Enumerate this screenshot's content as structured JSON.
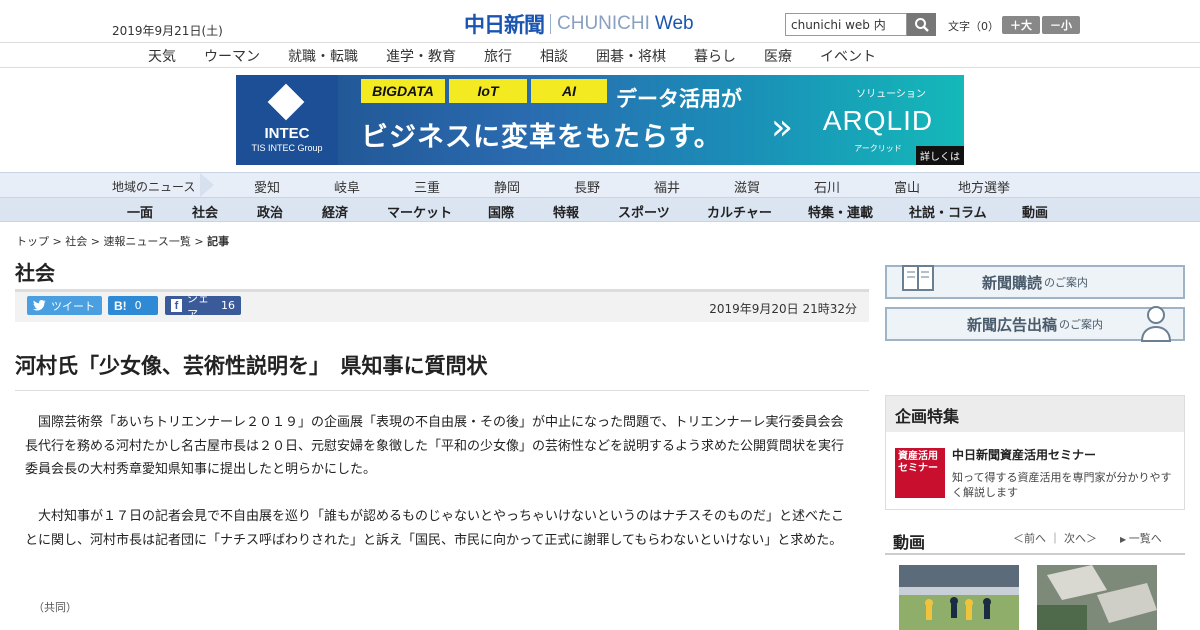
{
  "header": {
    "date": "2019年9月21日(土)",
    "logo_kanji": "中日新聞",
    "logo_latin": "CHUNICHI",
    "logo_web": "Web",
    "search_value": "chunichi web 内",
    "font_size_label": "文字（0）",
    "font_larger": "＋大",
    "font_smaller": "－小"
  },
  "category_nav": [
    "天気",
    "ウーマン",
    "就職・転職",
    "進学・教育",
    "旅行",
    "相談",
    "囲碁・将棋",
    "暮らし",
    "医療",
    "イベント"
  ],
  "banner": {
    "company": "INTEC",
    "company_sub": "TIS INTEC Group",
    "tags": [
      "BIGDATA",
      "IoT",
      "AI"
    ],
    "line1": "データ活用が",
    "line2": "ビジネスに変革をもたらす。",
    "solution": "ソリューション",
    "product": "ARQLID",
    "product_sub": "アークリッド",
    "more": "詳しくは"
  },
  "regional_nav": {
    "label": "地域のニュース",
    "items": [
      "愛知",
      "岐阜",
      "三重",
      "静岡",
      "長野",
      "福井",
      "滋賀",
      "石川",
      "富山",
      "地方選挙"
    ]
  },
  "section_nav": [
    "一面",
    "社会",
    "政治",
    "経済",
    "マーケット",
    "国際",
    "特報",
    "スポーツ",
    "カルチャー",
    "特集・連載",
    "社説・コラム",
    "動画"
  ],
  "breadcrumb": {
    "items": [
      "トップ",
      "社会",
      "速報ニュース一覧"
    ],
    "separator": " > ",
    "current": "記事"
  },
  "section_title": "社会",
  "share": {
    "tweet": "ツイート",
    "hatena_count": "0",
    "fb_label": "シェア",
    "fb_count": "16",
    "published": "2019年9月20日 21時32分"
  },
  "article": {
    "headline": "河村氏「少女像、芸術性説明を」　県知事に質問状",
    "paragraphs": [
      "国際芸術祭「あいちトリエンナーレ２０１９」の企画展「表現の不自由展・その後」が中止になった問題で、トリエンナーレ実行委員会会長代行を務める河村たかし名古屋市長は２０日、元慰安婦を象徴した「平和の少女像」の芸術性などを説明するよう求めた公開質問状を実行委員会長の大村秀章愛知県知事に提出したと明らかにした。",
      "大村知事が１７日の記者会見で不自由展を巡り「誰もが認めるものじゃないとやっちゃいけないというのはナチスそのものだ」と述べたことに関し、河村市長は記者団に「ナチス呼ばわりされた」と訴え「国民、市民に向かって正式に謝罪してもらわないといけない」と求めた。"
    ],
    "credit": "（共同）"
  },
  "sidebar": {
    "subscribe_title": "新聞購読",
    "subscribe_sub": "のご案内",
    "ad_title": "新聞広告出稿",
    "ad_sub": "のご案内",
    "kikaku_heading": "企画特集",
    "kikaku_thumb_text": "資産活用セミナー",
    "kikaku_title": "中日新聞資産活用セミナー",
    "kikaku_desc": "知って得する資産活用を専門家が分かりやすく解説します",
    "video_heading": "動画",
    "video_prev": "＜前へ",
    "video_next": "次へ＞",
    "video_list": "一覧へ"
  },
  "colors": {
    "brand_blue": "#1a55b0",
    "nav_bg": "#dbe5f2",
    "twitter": "#4a9fe0",
    "hatena": "#2f8ad6",
    "facebook": "#3b5a9a"
  }
}
